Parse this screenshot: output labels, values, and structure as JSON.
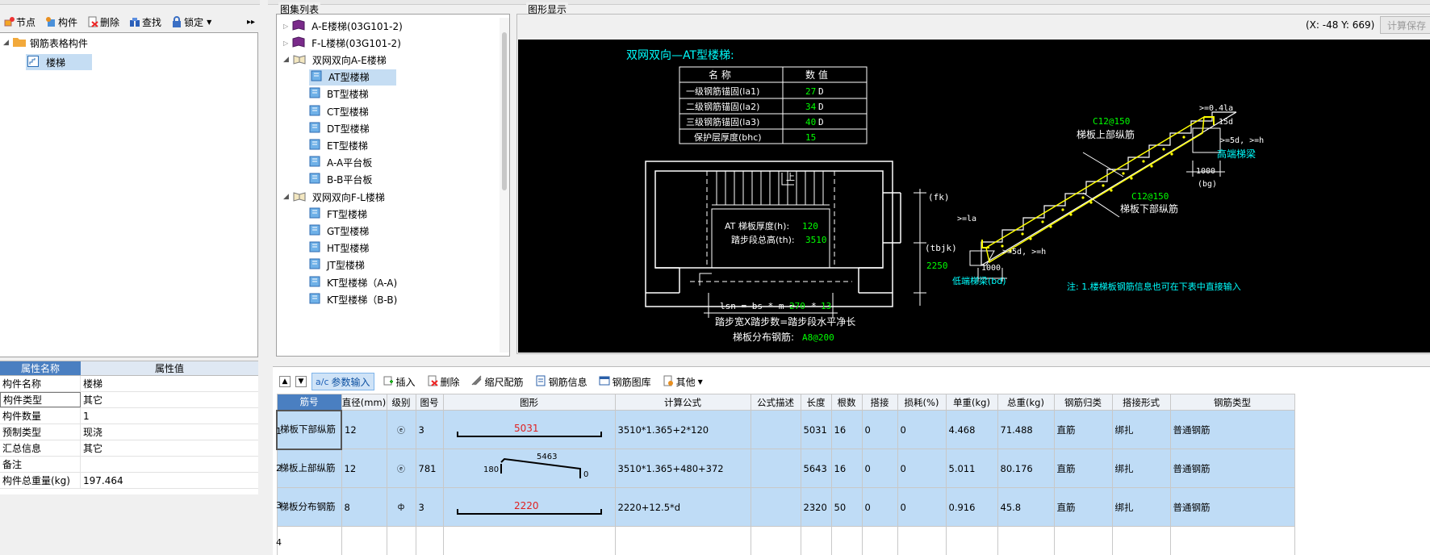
{
  "left_toolbar": [
    {
      "label": "节点",
      "icon": "node-icon"
    },
    {
      "label": "构件",
      "icon": "component-icon"
    },
    {
      "label": "删除",
      "icon": "delete-icon"
    },
    {
      "label": "查找",
      "icon": "search-icon"
    },
    {
      "label": "锁定",
      "icon": "lock-icon"
    }
  ],
  "left_tree": {
    "root": "钢筋表格构件",
    "child": "楼梯"
  },
  "properties": {
    "header_name": "属性名称",
    "header_value": "属性值",
    "rows": [
      {
        "k": "构件名称",
        "v": "楼梯"
      },
      {
        "k": "构件类型",
        "v": "其它"
      },
      {
        "k": "构件数量",
        "v": "1"
      },
      {
        "k": "预制类型",
        "v": "现浇"
      },
      {
        "k": "汇总信息",
        "v": "其它"
      },
      {
        "k": "备注",
        "v": ""
      },
      {
        "k": "构件总重量(kg)",
        "v": "197.464"
      }
    ]
  },
  "atlas_panel": {
    "title": "图集列表",
    "items": [
      "A-E楼梯(03G101-2)",
      "F-L楼梯(03G101-2)",
      "双网双向A-E楼梯",
      "AT型楼梯",
      "BT型楼梯",
      "CT型楼梯",
      "DT型楼梯",
      "ET型楼梯",
      "A-A平台板",
      "B-B平台板",
      "双网双向F-L楼梯",
      "FT型楼梯",
      "GT型楼梯",
      "HT型楼梯",
      "JT型楼梯",
      "KT型楼梯（A-A)",
      "KT型楼梯（B-B)"
    ]
  },
  "display_panel": {
    "title": "图形显示",
    "coords": "(X: -48 Y: 669)",
    "calc_save": "计算保存"
  },
  "drawing": {
    "title": "双网双向—AT型楼梯:",
    "table_head": [
      "名 称",
      "数 值"
    ],
    "table_rows": [
      {
        "name": "一级钢筋锚固(la1)",
        "value": "27",
        "unit": "D"
      },
      {
        "name": "二级钢筋锚固(la2)",
        "value": "34",
        "unit": "D"
      },
      {
        "name": "三级钢筋锚固(la3)",
        "value": "40",
        "unit": "D"
      },
      {
        "name": "保护层厚度(bhc)",
        "value": "15",
        "unit": ""
      }
    ],
    "plan_label_thickness": "AT 梯板厚度(h):",
    "plan_value_thickness": "120",
    "plan_label_height": "踏步段总高(th):",
    "plan_value_height": "3510",
    "plan_upstairs": "上",
    "plan_fk": "(fk)",
    "plan_tbjk": "(tbjk)",
    "plan_tbjk_value": "2250",
    "formula_lsn": "lsn = bs * m =",
    "formula_lsn_bs": "270",
    "formula_lsn_star": "*",
    "formula_lsn_m": "13",
    "formula_text": "踏步宽X踏步数=踏步段水平净长",
    "distribution_label": "梯板分布钢筋:",
    "distribution_value": "A8@200",
    "sec_upper_rebar": "C12@150",
    "sec_upper_label": "梯板上部纵筋",
    "sec_lower_rebar": "C12@150",
    "sec_lower_label": "梯板下部纵筋",
    "sec_041a": ">=0.4la",
    "sec_15d": "15d",
    "sec_5dh_top": ">=5d, >=h",
    "sec_high_beam": "高端梯梁",
    "sec_1000_top": "1000",
    "sec_bg": "(bg)",
    "sec_la": ">=la",
    "sec_5dh_bottom": ">=5d, >=h",
    "sec_1000_bottom": "1000",
    "sec_low_beam": "低端梯梁(bd)",
    "note": "注: 1.楼梯板钢筋信息也可在下表中直接输入"
  },
  "grid_toolbar": [
    {
      "label": "参数输入",
      "icon": "param-input-icon",
      "active": true
    },
    {
      "label": "插入",
      "icon": "insert-icon"
    },
    {
      "label": "删除",
      "icon": "delete-icon"
    },
    {
      "label": "缩尺配筋",
      "icon": "scale-rebar-icon"
    },
    {
      "label": "钢筋信息",
      "icon": "rebar-info-icon"
    },
    {
      "label": "钢筋图库",
      "icon": "rebar-library-icon"
    },
    {
      "label": "其他",
      "icon": "other-icon"
    }
  ],
  "grid": {
    "headers": [
      "筋号",
      "直径(mm)",
      "级别",
      "图号",
      "图形",
      "计算公式",
      "公式描述",
      "长度",
      "根数",
      "搭接",
      "损耗(%)",
      "单重(kg)",
      "总重(kg)",
      "钢筋归类",
      "搭接形式",
      "钢筋类型"
    ],
    "rows": [
      {
        "no": "1",
        "name": "梯板下部纵筋",
        "dia": "12",
        "grade": "ⓔ",
        "fig": "3",
        "shape_label": "5031",
        "formula": "3510*1.365+2*120",
        "desc": "",
        "length": "5031",
        "count": "16",
        "lap": "0",
        "loss": "0",
        "unit_w": "4.468",
        "total_w": "71.488",
        "cat": "直筋",
        "lap_type": "绑扎",
        "type": "普通钢筋"
      },
      {
        "no": "2",
        "name": "梯板上部纵筋",
        "dia": "12",
        "grade": "ⓔ",
        "fig": "781",
        "shape_label": "5463",
        "shape_left": "180",
        "shape_right": "0",
        "formula": "3510*1.365+480+372",
        "desc": "",
        "length": "5643",
        "count": "16",
        "lap": "0",
        "loss": "0",
        "unit_w": "5.011",
        "total_w": "80.176",
        "cat": "直筋",
        "lap_type": "绑扎",
        "type": "普通钢筋"
      },
      {
        "no": "3",
        "name": "梯板分布钢筋",
        "dia": "8",
        "grade": "ф",
        "fig": "3",
        "shape_label": "2220",
        "formula": "2220+12.5*d",
        "desc": "",
        "length": "2320",
        "count": "50",
        "lap": "0",
        "loss": "0",
        "unit_w": "0.916",
        "total_w": "45.8",
        "cat": "直筋",
        "lap_type": "绑扎",
        "type": "普通钢筋"
      }
    ],
    "empty_row_no": "4"
  },
  "colors": {
    "green": "#00ff00",
    "cyan": "#00ffff",
    "yellow": "#ffff00",
    "white": "#ffffff",
    "row_sel": "#bfdcf6"
  }
}
